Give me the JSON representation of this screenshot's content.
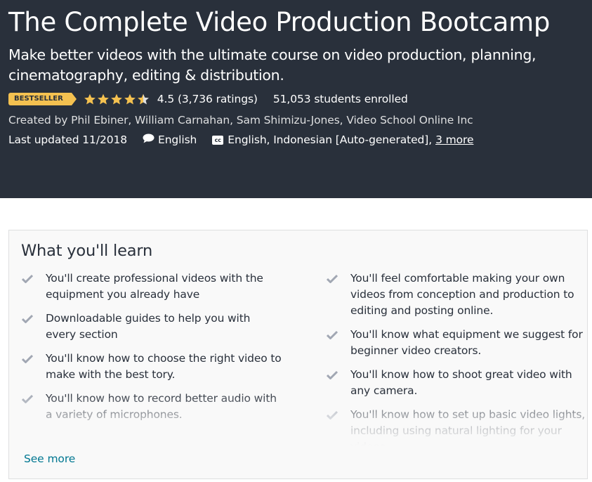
{
  "course": {
    "title": "The Complete Video Production Bootcamp",
    "subtitle": "Make better videos with the ultimate course on video production, planning, cinematography, editing & distribution.",
    "badge": "BESTSELLER",
    "rating": {
      "value": 4.5,
      "max": 5,
      "text": "4.5 (3,736 ratings)"
    },
    "enrolled": "51,053 students enrolled",
    "created_by": "Created by Phil Ebiner, William Carnahan, Sam Shimizu-Jones, Video School Online Inc",
    "last_updated": "Last updated 11/2018",
    "language": "English",
    "captions": "English, Indonesian [Auto-generated],",
    "captions_more": "3 more",
    "icons": {
      "language": "speech-bubble-icon",
      "captions": "closed-captions-icon",
      "cc_label": "cc"
    }
  },
  "learn": {
    "heading": "What you'll learn",
    "left_items": [
      "You'll create professional videos with the equipment you already have",
      "Downloadable guides to help you with every section",
      "You'll know how to choose the right video to make with the best tory.",
      "You'll know how to record better audio with a variety of microphones."
    ],
    "right_items": [
      "You'll feel comfortable making your own videos from conception and production to editing and posting online.",
      "You'll know what equipment we suggest for beginner video creators.",
      "You'll know how to shoot great video with any camera.",
      "You'll know how to set up basic video lights, including using natural lighting for your videos"
    ],
    "see_more": "See more"
  },
  "colors": {
    "hero_bg": "#29303b",
    "badge": "#f4c150",
    "star": "#f4c150",
    "link": "#007791",
    "check": "#a1a7b3"
  }
}
